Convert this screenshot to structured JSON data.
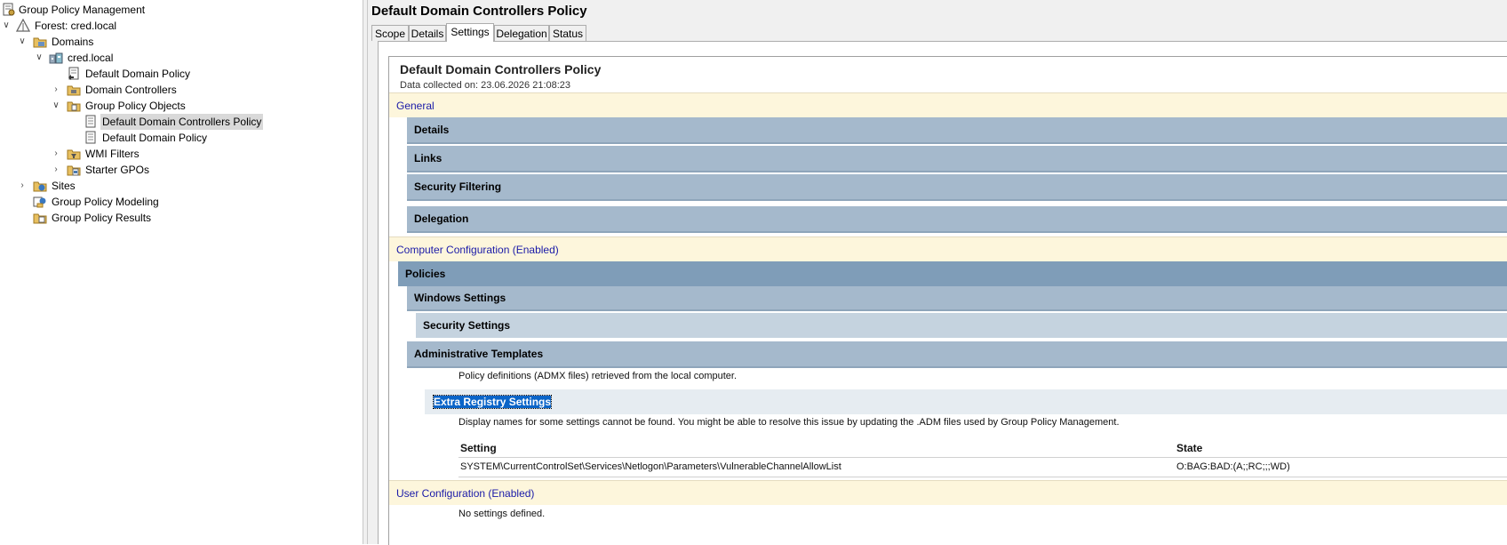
{
  "tree": {
    "root": "Group Policy Management",
    "forest": "Forest: cred.local",
    "domains": "Domains",
    "domain": "cred.local",
    "default_domain_policy_link": "Default Domain Policy",
    "domain_controllers_ou": "Domain Controllers",
    "gpo_container": "Group Policy Objects",
    "gpo_selected": "Default Domain Controllers Policy",
    "gpo_default": "Default Domain Policy",
    "wmi_filters": "WMI Filters",
    "starter_gpos": "Starter GPOs",
    "sites": "Sites",
    "modeling": "Group Policy Modeling",
    "results": "Group Policy Results"
  },
  "right": {
    "title": "Default Domain Controllers Policy",
    "tabs": [
      "Scope",
      "Details",
      "Settings",
      "Delegation",
      "Status"
    ],
    "active_tab": "Settings"
  },
  "report": {
    "title": "Default Domain Controllers Policy",
    "collected": "Data collected on: 23.06.2026 21:08:23",
    "general": "General",
    "details": "Details",
    "links": "Links",
    "security_filtering": "Security Filtering",
    "delegation": "Delegation",
    "computer_config": "Computer Configuration (Enabled)",
    "policies": "Policies",
    "windows_settings": "Windows Settings",
    "security_settings": "Security Settings",
    "admin_templates": "Administrative Templates",
    "admx_note": "Policy definitions (ADMX files) retrieved from the local computer.",
    "extra_registry": "Extra Registry Settings",
    "display_names_note": "Display names for some settings cannot be found. You might be able to resolve this issue by updating the .ADM files used by Group Policy Management.",
    "table": {
      "headers": [
        "Setting",
        "State"
      ],
      "rows": [
        [
          "SYSTEM\\CurrentControlSet\\Services\\Netlogon\\Parameters\\VulnerableChannelAllowList",
          "O:BAG:BAD:(A;;RC;;;WD)"
        ]
      ]
    },
    "user_config": "User Configuration (Enabled)",
    "no_settings": "No settings defined."
  }
}
